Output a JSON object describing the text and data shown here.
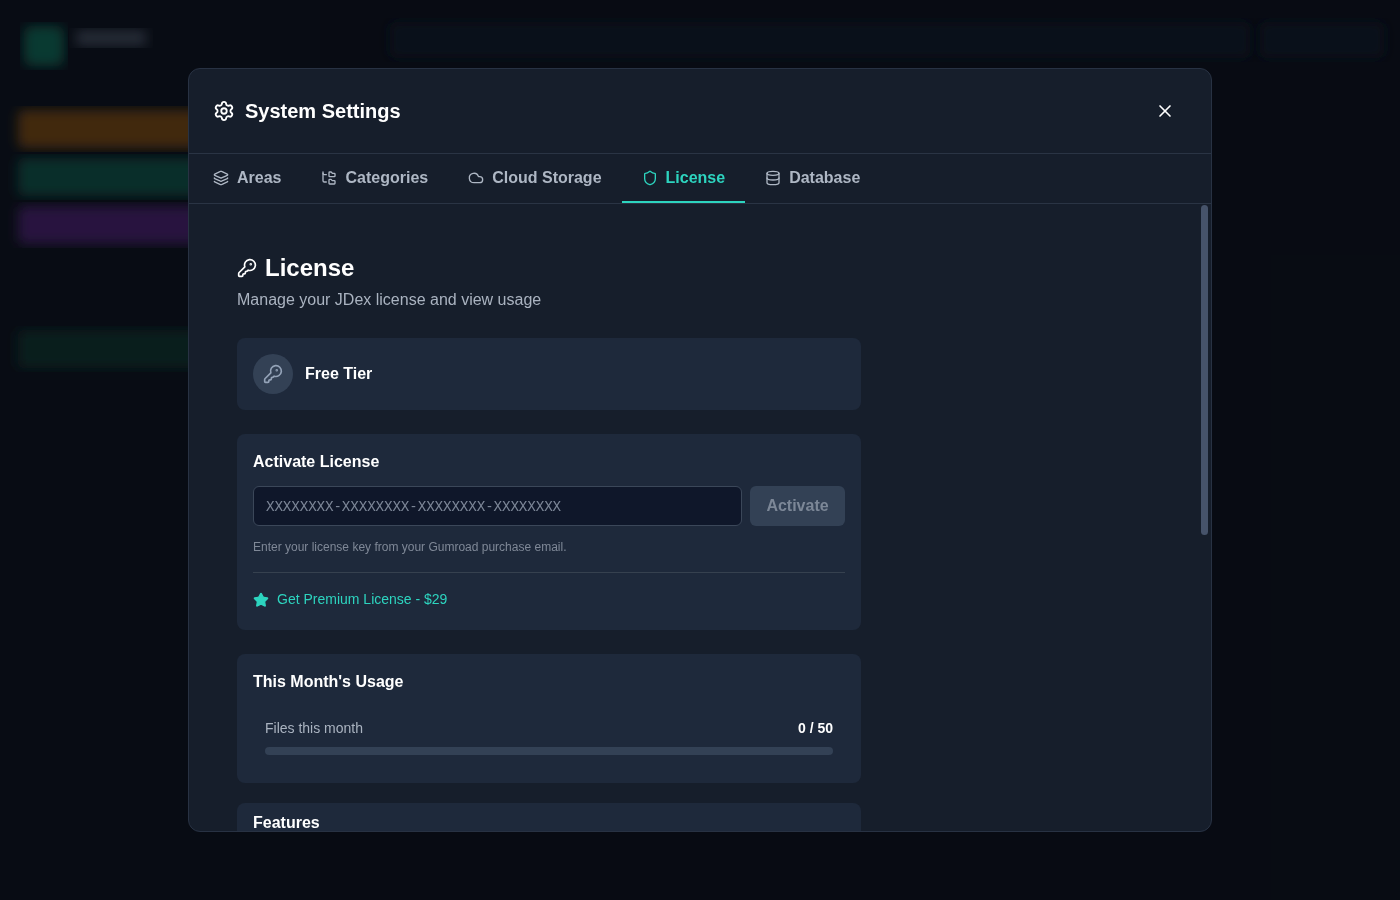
{
  "dialog": {
    "title": "System Settings"
  },
  "tabs": [
    {
      "label": "Areas",
      "selected": false
    },
    {
      "label": "Categories",
      "selected": false
    },
    {
      "label": "Cloud Storage",
      "selected": false
    },
    {
      "label": "License",
      "selected": true
    },
    {
      "label": "Database",
      "selected": false
    }
  ],
  "license": {
    "title": "License",
    "subtitle": "Manage your JDex license and view usage",
    "tier": "Free Tier",
    "activate": {
      "title": "Activate License",
      "placeholder": "XXXXXXXX-XXXXXXXX-XXXXXXXX-XXXXXXXX",
      "button": "Activate",
      "disabled": true,
      "hint": "Enter your license key from your Gumroad purchase email.",
      "premium_link": "Get Premium License - $29"
    },
    "usage": {
      "title": "This Month's Usage",
      "label": "Files this month",
      "reading": "0 / 50",
      "level": 0
    },
    "features": {
      "title": "Features"
    }
  }
}
